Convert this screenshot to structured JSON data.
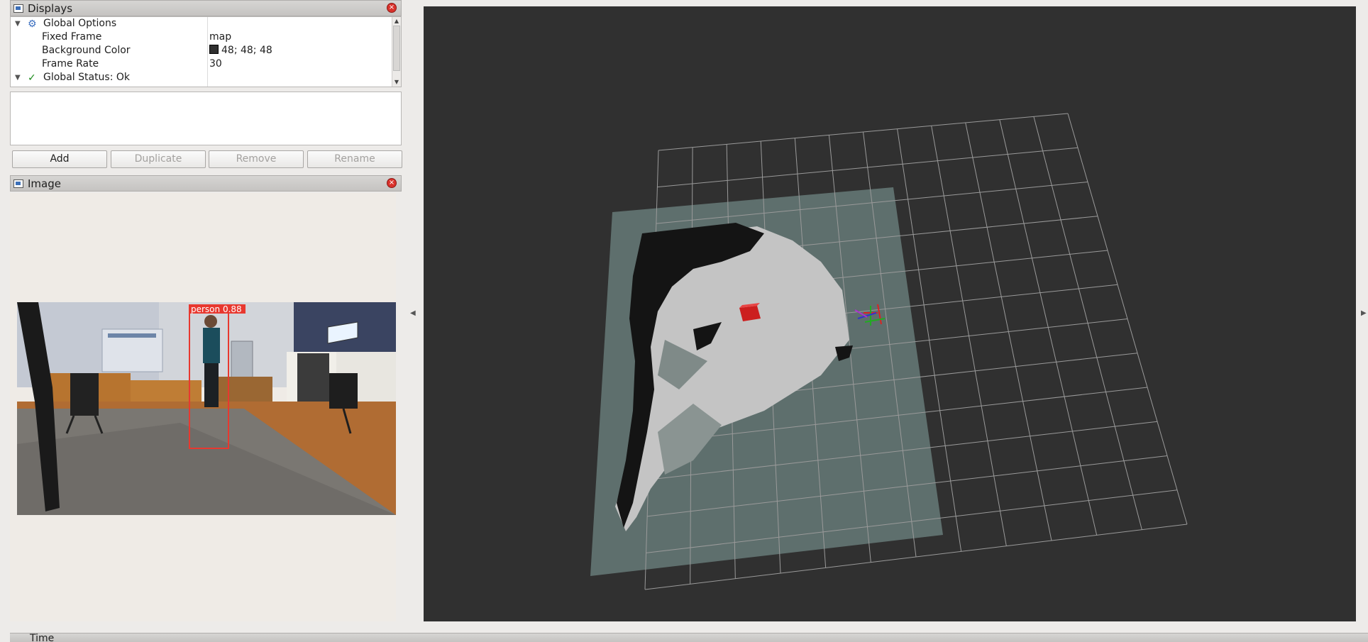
{
  "displays_panel": {
    "title": "Displays",
    "close_label": "×",
    "tree": [
      {
        "label": "Global Options",
        "value": "",
        "icon": "gear-icon",
        "expanded": true
      },
      {
        "label": "Fixed Frame",
        "value": "map"
      },
      {
        "label": "Background Color",
        "value": "48; 48; 48",
        "swatch_color": "#303030"
      },
      {
        "label": "Frame Rate",
        "value": "30"
      },
      {
        "label": "Global Status: Ok",
        "value": "",
        "icon": "check-icon",
        "expanded": true
      }
    ],
    "buttons": {
      "add": "Add",
      "duplicate": "Duplicate",
      "remove": "Remove",
      "rename": "Rename"
    }
  },
  "image_panel": {
    "title": "Image",
    "close_label": "×",
    "detection_label": "person 0.88"
  },
  "time_panel": {
    "title": "Time"
  },
  "colors": {
    "background": "#303030",
    "grid": "#a0a0a0",
    "occupancy_plane": "#5e6f6d",
    "free_space": "#c4c4c4",
    "obstacles": "#141414",
    "marker": "#cc1f1f",
    "detection_box": "#e8382f"
  },
  "icons": [
    "displays-icon",
    "image-icon",
    "time-icon",
    "gear-icon",
    "check-icon",
    "close-icon"
  ]
}
